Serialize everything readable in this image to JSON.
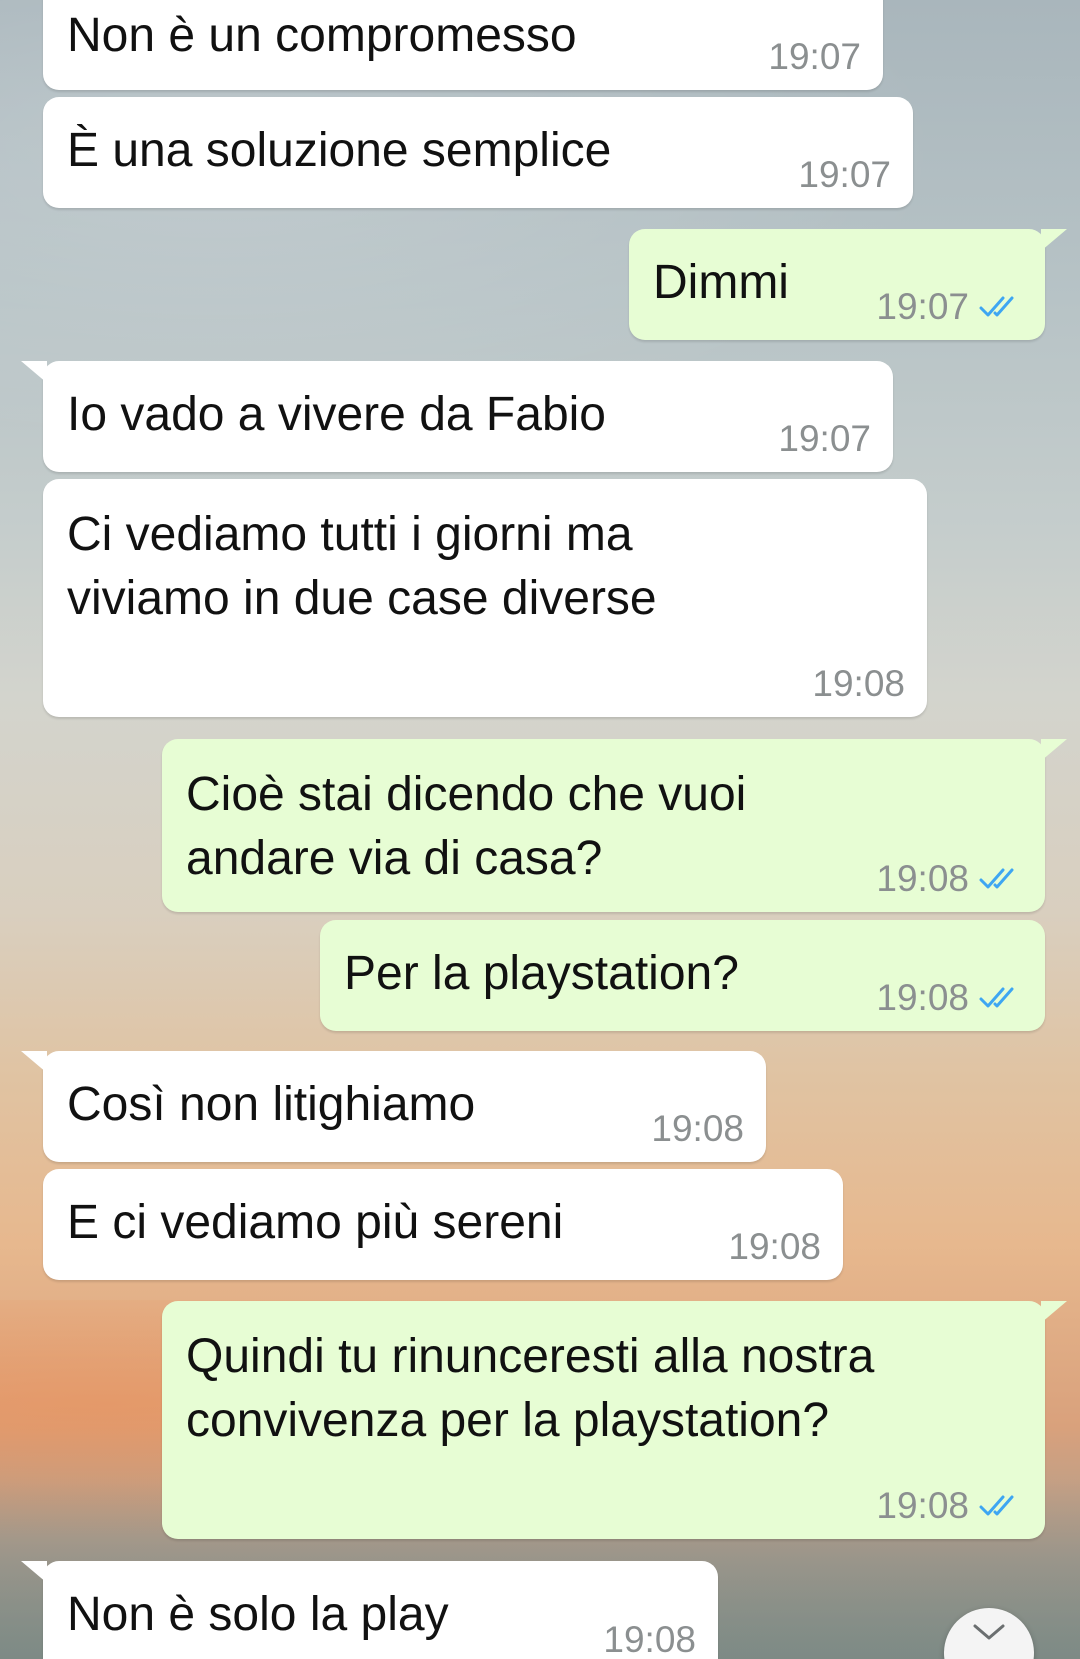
{
  "messages": [
    {
      "text": "Non è un compromesso",
      "time": "19:07",
      "direction": "in"
    },
    {
      "text": "È una soluzione semplice",
      "time": "19:07",
      "direction": "in"
    },
    {
      "text": "Dimmi",
      "time": "19:07",
      "direction": "out",
      "status": "read"
    },
    {
      "text": "Io vado a vivere da Fabio",
      "time": "19:07",
      "direction": "in"
    },
    {
      "text": "Ci vediamo tutti i giorni ma\nviviamo in due case diverse",
      "time": "19:08",
      "direction": "in"
    },
    {
      "text": "Cioè stai dicendo che vuoi\nandare via di casa?",
      "time": "19:08",
      "direction": "out",
      "status": "read"
    },
    {
      "text": "Per la playstation?",
      "time": "19:08",
      "direction": "out",
      "status": "read"
    },
    {
      "text": "Così non litighiamo",
      "time": "19:08",
      "direction": "in"
    },
    {
      "text": "E ci vediamo più sereni",
      "time": "19:08",
      "direction": "in"
    },
    {
      "text": "Quindi tu rinunceresti alla nostra\nconvivenza per la playstation?",
      "time": "19:08",
      "direction": "out",
      "status": "read"
    },
    {
      "text": "Non è solo la play",
      "time": "19:08",
      "direction": "in"
    }
  ],
  "colors": {
    "incoming_bubble": "#ffffff",
    "outgoing_bubble": "#e7fdd4",
    "read_ticks": "#3ea6f2",
    "timestamp": "#8b8f90"
  },
  "icons": {
    "read_receipt": "double-check-icon",
    "scroll_down": "chevron-down-icon"
  }
}
